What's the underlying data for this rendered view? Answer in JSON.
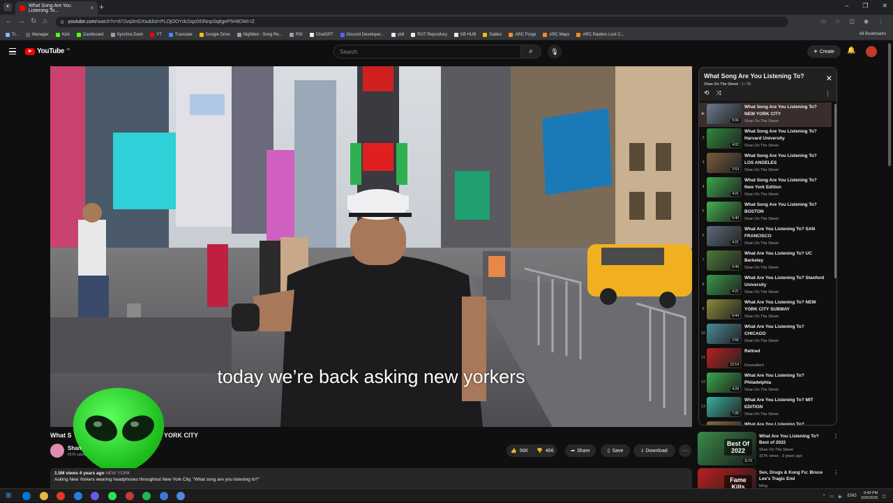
{
  "browser": {
    "tab_title": "What Song Are You Listening To...",
    "tab_close": "×",
    "new_tab": "+",
    "url_host": "youtube.com",
    "url_path": "/watch?v=872vq3mDXw&list=PLOjOOYdcDqz0Il3NnpSq8geP5H9DWI-IZ",
    "window_buttons": [
      "–",
      "❐",
      "✕"
    ],
    "bookmarks": [
      {
        "label": "Tr...",
        "color": "#8ab4f8"
      },
      {
        "label": "Manager",
        "color": "#5f6368"
      },
      {
        "label": "Kick",
        "color": "#53fc18"
      },
      {
        "label": "Dashboard",
        "color": "#53fc18"
      },
      {
        "label": "Synchra Dash",
        "color": "#9aa0a6"
      },
      {
        "label": "YT",
        "color": "#ff0000"
      },
      {
        "label": "Translate",
        "color": "#4285f4"
      },
      {
        "label": "Google Drive",
        "color": "#fbbc04"
      },
      {
        "label": "Nightbot - Song Re...",
        "color": "#9aa0a6"
      },
      {
        "label": "RSI",
        "color": "#9aa0a6"
      },
      {
        "label": "ChatGPT",
        "color": "#e8eaed"
      },
      {
        "label": "Discord Developer...",
        "color": "#5865f2"
      },
      {
        "label": "ytdl",
        "color": "#e8eaed"
      },
      {
        "label": "RGT Repository",
        "color": "#e8eaed"
      },
      {
        "label": "KB HUB",
        "color": "#e8eaed"
      },
      {
        "label": "Dailies",
        "color": "#fbbc04"
      },
      {
        "label": "ARC Forge",
        "color": "#f28b22"
      },
      {
        "label": "ARC Maps",
        "color": "#f28b22"
      },
      {
        "label": "ARC Raiders Loot C...",
        "color": "#f28b22"
      }
    ],
    "all_bookmarks": "All Bookmarks"
  },
  "youtube": {
    "logo_text": "YouTube",
    "logo_tm": "TR",
    "search_placeholder": "Search",
    "create_label": "Create",
    "video": {
      "caption": "today we’re back asking new yorkers",
      "title_start": "What S",
      "title_end": "YORK CITY",
      "channel_name": "Shan",
      "subscribers": "657K subsc...",
      "likes": "56K",
      "dislikes": "466",
      "share": "Share",
      "save": "Save",
      "download": "Download",
      "more": "···",
      "views_meta": "1.5M views  4 years ago",
      "location_tag": "NEW YORK",
      "description": "Asking New Yorkers wearing headphones throughout New York City, \"What song are you listening to?\""
    },
    "playlist": {
      "title": "What Song Are You Listening To?",
      "channel": "Shan On The Street",
      "position": " - 1 / 35",
      "close": "✕",
      "items": [
        {
          "index": "▶",
          "title": "What Song Are You Listening To? NEW YORK CITY",
          "channel": "Shan On The Street",
          "duration": "5:06",
          "active": true,
          "color": "#6b7a8f"
        },
        {
          "index": "2",
          "title": "What Song Are You Listening To? Harvard University",
          "channel": "Shan On The Street",
          "duration": "4:02",
          "color": "#2e8b3a"
        },
        {
          "index": "3",
          "title": "What Song Are You Listening To? LOS ANGELES",
          "channel": "Shan On The Street",
          "duration": "2:53",
          "color": "#7a5b3a"
        },
        {
          "index": "4",
          "title": "What Song Are You Listening To? New York Edition",
          "channel": "Shan On The Street",
          "duration": "4:21",
          "color": "#3aa84a"
        },
        {
          "index": "5",
          "title": "What Song Are You Listening To? BOSTON",
          "channel": "Shan On The Street",
          "duration": "5:40",
          "color": "#45b34f"
        },
        {
          "index": "6",
          "title": "What Are You Listening To? SAN FRANCISCO",
          "channel": "Shan On The Street",
          "duration": "4:21",
          "color": "#5a6b7a"
        },
        {
          "index": "7",
          "title": "What Are You Listening To? UC Berkeley",
          "channel": "Shan On The Street",
          "duration": "6:49",
          "color": "#4a7a3a"
        },
        {
          "index": "8",
          "title": "What Are You Listening To? Stanford University",
          "channel": "Shan On The Street",
          "duration": "4:21",
          "color": "#3a9a4a"
        },
        {
          "index": "9",
          "title": "What Are You Listening To? NEW YORK CITY SUBWAY",
          "channel": "Shan On The Street",
          "duration": "5:44",
          "color": "#8a8a3a"
        },
        {
          "index": "10",
          "title": "What Are You Listening To? CHICAGO",
          "channel": "Shan On The Street",
          "duration": "2:56",
          "color": "#4a8a9a"
        },
        {
          "index": "11",
          "title": "Retired",
          "channel": "DramaAlert",
          "duration": "12:14",
          "color": "#b82020"
        },
        {
          "index": "12",
          "title": "What Are You Listening To? Philadelphia",
          "channel": "Shan On The Street",
          "duration": "4:29",
          "color": "#3aa84a"
        },
        {
          "index": "13",
          "title": "What Are You Listening To? MIT EDITION",
          "channel": "Shan On The Street",
          "duration": "7:26",
          "color": "#3ab0a0"
        },
        {
          "index": "14",
          "title": "What Are You Listening To?",
          "channel": "Shan On The Street",
          "duration": "",
          "color": "#8a6a3a"
        }
      ]
    },
    "recommended": [
      {
        "title": "What Are You Listening To? Best of 2022",
        "channel": "Shan On The Street",
        "meta": "327K views · 3 years ago",
        "duration": "11:01",
        "thumb_text": "Best Of 2022",
        "color": "#3a8a4a"
      },
      {
        "title": "Sex, Drugs & Kung Fu: Bruce Lee's Tragic End",
        "channel": "Mlng",
        "meta": "",
        "duration": "",
        "thumb_text": "Fame Kills",
        "color": "#b82020"
      }
    ]
  },
  "taskbar": {
    "lang": "ENG",
    "time": "9:49 PM",
    "date": "3/20/2026",
    "apps": [
      "#0078d4",
      "#e8b93a",
      "#e03a2a",
      "#2a7ae0",
      "#6a5ae0",
      "#2ae05a",
      "#c03a3a",
      "#1db954",
      "#3a7ad0",
      "#4a8ae0"
    ]
  }
}
